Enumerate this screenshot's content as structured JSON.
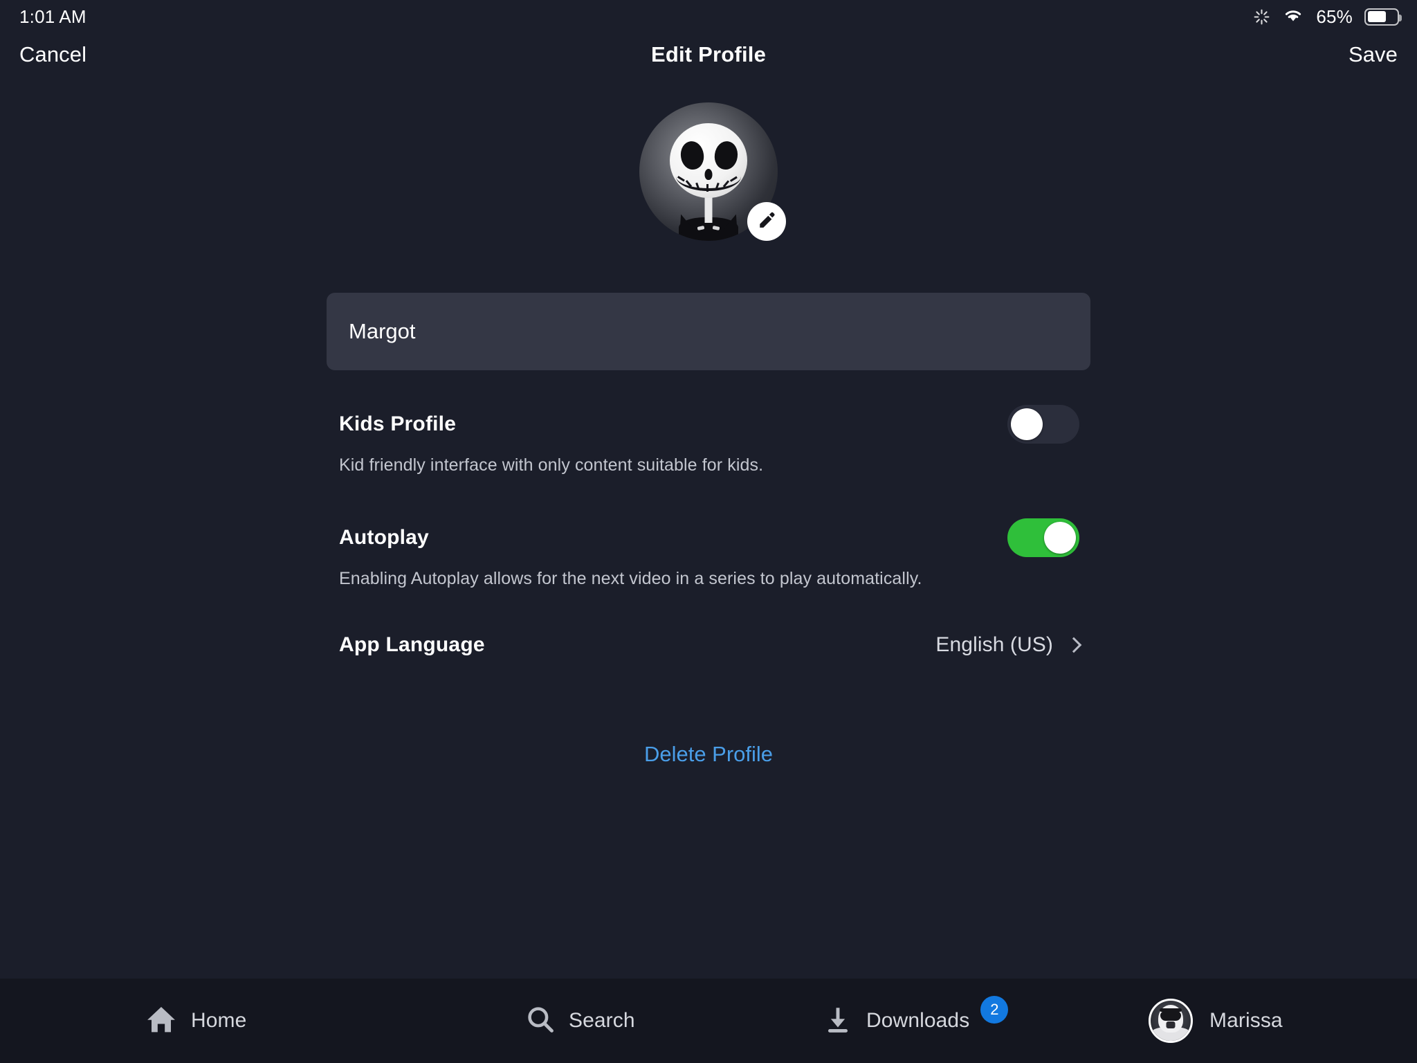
{
  "status_bar": {
    "time": "1:01 AM",
    "battery_percent": "65%",
    "icons": [
      "sync-icon",
      "wifi-icon",
      "battery-icon"
    ]
  },
  "nav_bar": {
    "cancel_label": "Cancel",
    "title": "Edit Profile",
    "save_label": "Save"
  },
  "avatar": {
    "name": "jack-skellington-avatar",
    "edit_icon": "pencil-icon"
  },
  "name_field": {
    "value": "Margot",
    "placeholder": "Profile name"
  },
  "settings": {
    "kids_profile": {
      "title": "Kids Profile",
      "description": "Kid friendly interface with only content suitable for kids.",
      "enabled": "off"
    },
    "autoplay": {
      "title": "Autoplay",
      "description": "Enabling Autoplay allows for the next video in a series to play automatically.",
      "enabled": "on"
    },
    "app_language": {
      "title": "App Language",
      "value": "English (US)",
      "chevron": "chevron-right-icon"
    }
  },
  "delete_profile": {
    "label": "Delete Profile",
    "color": "#4a9ee8"
  },
  "tab_bar": {
    "items": [
      {
        "label": "Home",
        "icon": "home-icon"
      },
      {
        "label": "Search",
        "icon": "search-icon"
      },
      {
        "label": "Downloads",
        "icon": "download-icon",
        "badge": "2"
      },
      {
        "label": "Marissa",
        "icon": "stormtrooper-avatar"
      }
    ]
  },
  "colors": {
    "background": "#1b1e2a",
    "tabbar_background": "#14161f",
    "field_background": "#343745",
    "toggle_on": "#2fbf3a",
    "toggle_off": "#2b2e3c",
    "badge_blue": "#1279e0",
    "link_blue": "#4a9ee8"
  }
}
